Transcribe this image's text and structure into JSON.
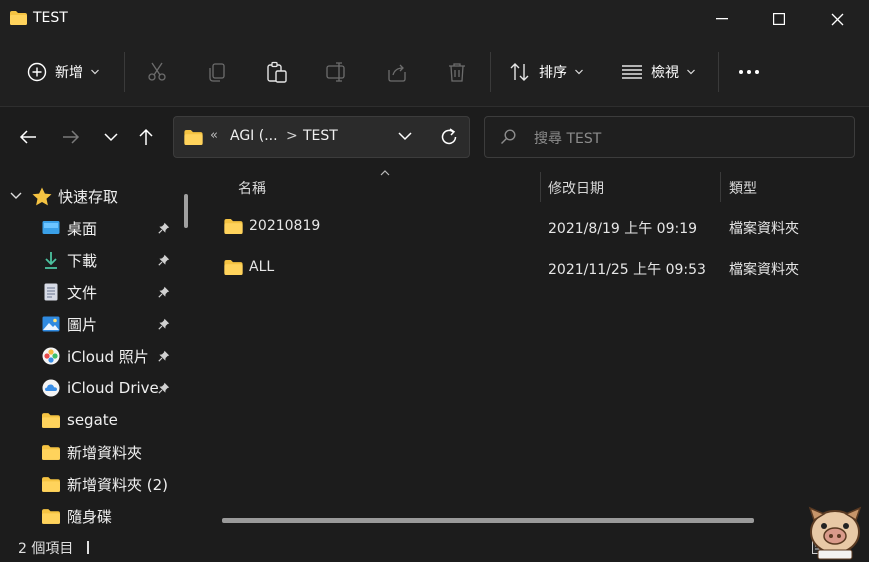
{
  "window": {
    "title": "TEST"
  },
  "toolbar": {
    "new_label": "新增",
    "sort_label": "排序",
    "view_label": "檢視"
  },
  "address": {
    "ellipsis": "«",
    "parent": "AGI (...",
    "separator": ">",
    "current": "TEST"
  },
  "search": {
    "placeholder": "搜尋 TEST"
  },
  "sidebar": {
    "quick_access": "快速存取",
    "items": [
      {
        "label": "桌面",
        "icon": "desktop-icon",
        "pinned": true
      },
      {
        "label": "下載",
        "icon": "download-icon",
        "pinned": true
      },
      {
        "label": "文件",
        "icon": "document-icon",
        "pinned": true
      },
      {
        "label": "圖片",
        "icon": "pictures-icon",
        "pinned": true
      },
      {
        "label": "iCloud 照片",
        "icon": "icloud-photos-icon",
        "pinned": true
      },
      {
        "label": "iCloud Drive",
        "icon": "icloud-drive-icon",
        "pinned": true
      },
      {
        "label": "segate",
        "icon": "folder-icon",
        "pinned": false
      },
      {
        "label": "新增資料夾",
        "icon": "folder-icon",
        "pinned": false
      },
      {
        "label": "新增資料夾 (2)",
        "icon": "folder-icon",
        "pinned": false
      },
      {
        "label": "隨身碟",
        "icon": "folder-icon",
        "pinned": false
      }
    ]
  },
  "columns": {
    "name": "名稱",
    "modified": "修改日期",
    "type": "類型"
  },
  "files": [
    {
      "name": "20210819",
      "modified": "2021/8/19 上午 09:19",
      "type": "檔案資料夾"
    },
    {
      "name": "ALL",
      "modified": "2021/11/25 上午 09:53",
      "type": "檔案資料夾"
    }
  ],
  "status": {
    "count": "2 個項目"
  },
  "colors": {
    "background": "#1c1c1c",
    "chrome": "#202020",
    "folder": "#f5c342",
    "accent": "#4cc2ff"
  }
}
